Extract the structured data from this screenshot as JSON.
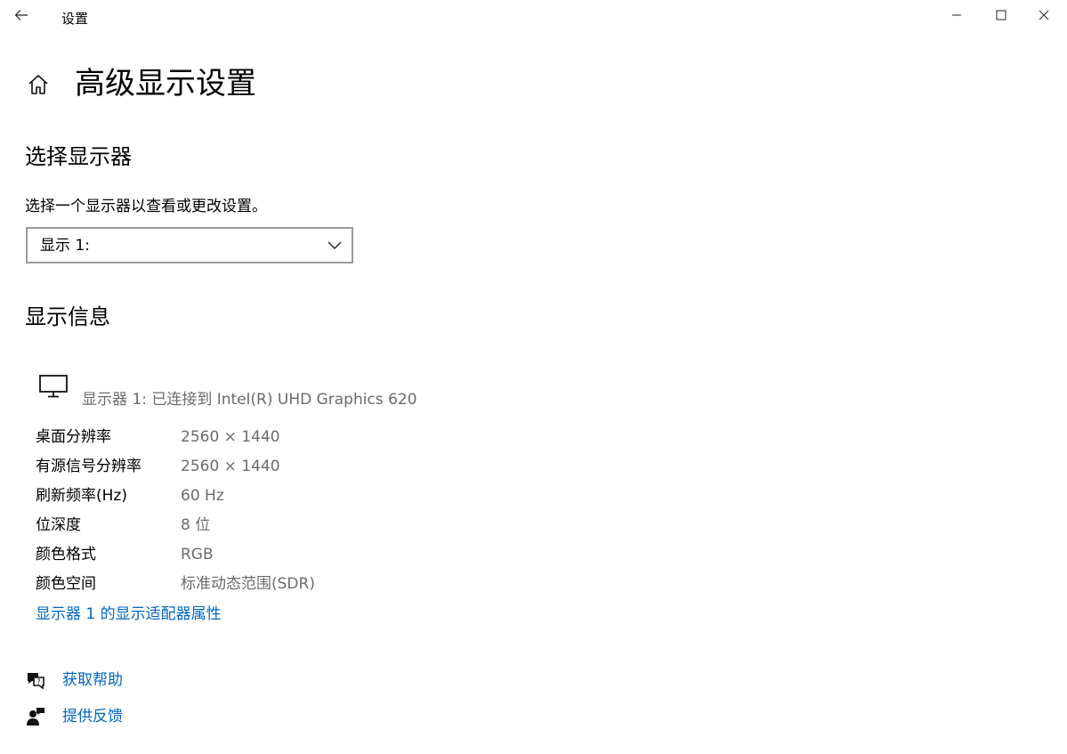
{
  "window": {
    "title": "设置",
    "back_icon": "back-arrow-icon",
    "minimize_icon": "minimize-icon",
    "maximize_icon": "maximize-icon",
    "close_icon": "close-icon"
  },
  "header": {
    "home_icon": "home-icon",
    "title": "高级显示设置"
  },
  "select_display": {
    "heading": "选择显示器",
    "description": "选择一个显示器以查看或更改设置。",
    "selected_value": "显示 1:",
    "chevron_icon": "chevron-down-icon"
  },
  "display_info": {
    "heading": "显示信息",
    "monitor_icon": "monitor-icon",
    "monitor_label": "显示器 1: 已连接到 Intel(R) UHD Graphics 620",
    "rows": [
      {
        "label": "桌面分辨率",
        "value": "2560 × 1440"
      },
      {
        "label": "有源信号分辨率",
        "value": "2560 × 1440"
      },
      {
        "label": "刷新频率(Hz)",
        "value": "60 Hz"
      },
      {
        "label": "位深度",
        "value": "8 位"
      },
      {
        "label": "颜色格式",
        "value": "RGB"
      },
      {
        "label": "颜色空间",
        "value": "标准动态范围(SDR)"
      }
    ],
    "adapter_link": "显示器 1 的显示适配器属性"
  },
  "help": {
    "get_help": "获取帮助",
    "get_help_icon": "chat-help-icon",
    "feedback": "提供反馈",
    "feedback_icon": "feedback-icon"
  },
  "colors": {
    "link": "#0067c0",
    "secondary_text": "#6b6b6b",
    "select_border": "#9a9a9a"
  }
}
